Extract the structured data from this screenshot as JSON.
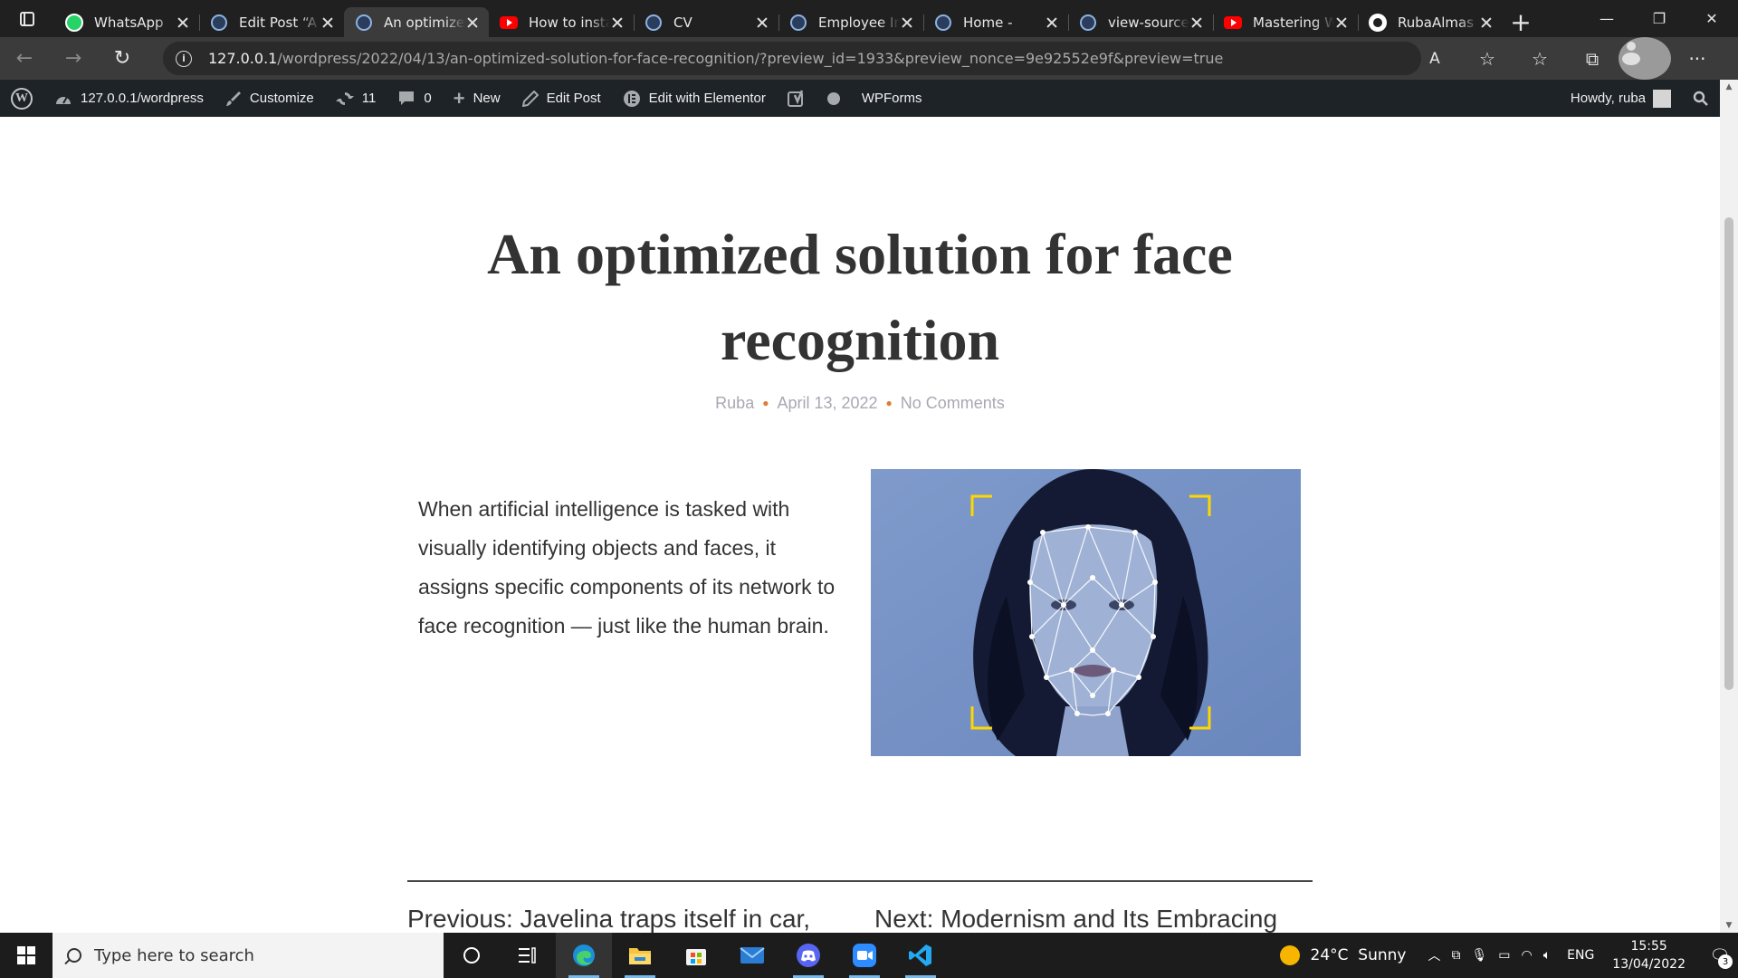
{
  "browser": {
    "tabs": [
      {
        "title": "WhatsApp",
        "icon": "whatsapp-icon",
        "active": false
      },
      {
        "title": "Edit Post “A",
        "icon": "wordpress-icon",
        "active": false
      },
      {
        "title": "An optimized",
        "icon": "wordpress-icon",
        "active": true
      },
      {
        "title": "How to install",
        "icon": "youtube-icon",
        "active": false
      },
      {
        "title": "CV",
        "icon": "wordpress-icon",
        "active": false
      },
      {
        "title": "Employee Info",
        "icon": "wordpress-icon",
        "active": false
      },
      {
        "title": "Home -",
        "icon": "wordpress-icon",
        "active": false
      },
      {
        "title": "view-source",
        "icon": "wordpress-icon",
        "active": false
      },
      {
        "title": "Mastering W",
        "icon": "youtube-icon",
        "active": false
      },
      {
        "title": "RubaAlmas",
        "icon": "github-icon",
        "active": false
      }
    ],
    "new_tab": "+",
    "window_controls": {
      "minimize": "—",
      "restore": "❐",
      "close": "✕"
    },
    "url_host": "127.0.0.1",
    "url_rest": "/wordpress/2022/04/13/an-optimized-solution-for-face-recognition/?preview_id=1933&preview_nonce=9e92552e9f&preview=true",
    "nav": {
      "back": "←",
      "forward": "→",
      "refresh": "↻"
    },
    "right_icons": {
      "read_aloud": "A",
      "favorite": "☆",
      "favorites": "☆",
      "collections": "⧉",
      "menu": "···"
    }
  },
  "adminbar": {
    "site": "127.0.0.1/wordpress",
    "customize": "Customize",
    "updates": "11",
    "comments": "0",
    "new": "New",
    "edit_post": "Edit Post",
    "elementor": "Edit with Elementor",
    "wpforms": "WPForms",
    "howdy": "Howdy, ruba"
  },
  "post": {
    "title": "An optimized solution for face recognition",
    "author": "Ruba",
    "date": "April 13, 2022",
    "comments": "No Comments",
    "excerpt": "When artificial intelligence is tasked with visually identifying objects and faces, it assigns specific components of its network to face recognition — just like the human brain.",
    "prev_link": "Previous: Javelina traps itself in car,",
    "next_link": "Next: Modernism and Its Embracing"
  },
  "taskbar": {
    "search_placeholder": "Type here to search",
    "weather": "24°C  Sunny",
    "lang": "ENG",
    "time": "15:55",
    "date": "13/04/2022",
    "notifications": "3"
  },
  "colors": {
    "title": "#333333",
    "meta": "#a8a8b3",
    "meta_separator": "#e07b39",
    "adminbar_bg": "#1d2327",
    "image_bg": "#6f8cc0",
    "face_mesh": "#ffffff",
    "frame_corners": "#ffd600"
  }
}
